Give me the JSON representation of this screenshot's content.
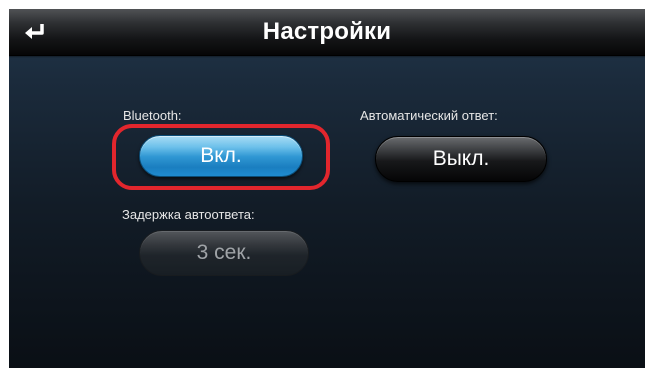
{
  "header": {
    "title": "Настройки",
    "back_icon": "return-arrow-icon"
  },
  "settings": {
    "bluetooth": {
      "label": "Bluetooth:",
      "value": "Вкл.",
      "state": "on"
    },
    "auto_answer": {
      "label": "Автоматический ответ:",
      "value": "Выкл.",
      "state": "off"
    },
    "auto_answer_delay": {
      "label": "Задержка автоответа:",
      "value": "3 сек.",
      "enabled": false
    }
  },
  "colors": {
    "accent_blue": "#2f97d3",
    "highlight_red": "#e2262d",
    "background_dark": "#121c27"
  }
}
